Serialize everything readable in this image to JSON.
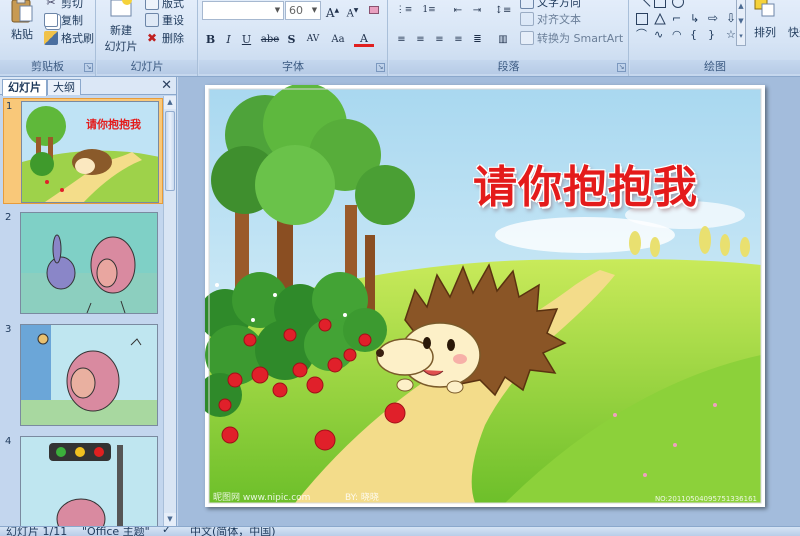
{
  "ribbon": {
    "clipboard": {
      "label": "剪贴板",
      "paste": "粘贴",
      "cut": "剪切",
      "copy": "复制",
      "format_painter": "格式刷"
    },
    "slides": {
      "label": "幻灯片",
      "new_slide_line1": "新建",
      "new_slide_line2": "幻灯片",
      "layout": "版式",
      "reset": "重设",
      "delete": "删除"
    },
    "font": {
      "label": "字体",
      "font_name": "",
      "font_size": "60",
      "grow": "A",
      "shrink": "A",
      "bold": "B",
      "italic": "I",
      "underline": "U",
      "strike": "abe",
      "shadow": "S",
      "spacing": "AV",
      "case": "Aa",
      "color": "A"
    },
    "paragraph": {
      "label": "段落",
      "text_direction": "文字方向",
      "align_text": "对齐文本",
      "smartart": "转换为 SmartArt"
    },
    "drawing": {
      "label": "绘图",
      "arrange": "排列",
      "quick_styles": "快速"
    }
  },
  "left_panel": {
    "tab_slides": "幻灯片",
    "tab_outline": "大纲",
    "close": "✕",
    "thumbnails": [
      {
        "number": "1",
        "title": "请你抱抱我",
        "selected": true
      },
      {
        "number": "2",
        "selected": false
      },
      {
        "number": "3",
        "selected": false
      },
      {
        "number": "4",
        "selected": false
      }
    ]
  },
  "slide": {
    "title": "请你抱抱我",
    "watermark_left": "昵图网 www.nipic.com",
    "watermark_mid": "BY: 晓晓",
    "watermark_right": "NO:20110504095751336161"
  },
  "statusbar": {
    "slide_count": "幻灯片 1/11",
    "theme": "\"Office 主题\"",
    "language": "中文(简体，中国)"
  },
  "colors": {
    "title_red": "#e41b1b",
    "selected_thumb": "#f9c879"
  }
}
